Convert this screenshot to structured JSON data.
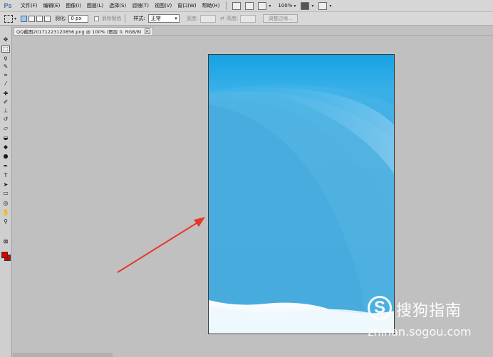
{
  "app": {
    "logo_text": "Ps"
  },
  "menubar": {
    "items": [
      "文件(F)",
      "编辑(E)",
      "图像(I)",
      "图层(L)",
      "选择(S)",
      "滤镜(T)",
      "视图(V)",
      "窗口(W)",
      "帮助(H)"
    ],
    "zoom_label": "100%",
    "arrow_glyph": "▾"
  },
  "options": {
    "feather_label": "羽化:",
    "feather_value": "0 px",
    "antialias_label": "消除锯齿",
    "style_label": "样式:",
    "style_value": "正常",
    "width_label": "宽度:",
    "height_label": "高度:",
    "refine_edge_label": "调整边缘..."
  },
  "document": {
    "tab_title": "QQ截图20171223120856.png @ 100% (图层 0, RGB/8)",
    "close_glyph": "×"
  },
  "watermark": {
    "logo_glyph": "S",
    "brand_text": "搜狗指南",
    "url_text": "zhinan.sogou.com"
  },
  "colors": {
    "foreground": "#e00000",
    "background": "#d40000",
    "arrow": "#e8352c",
    "sky_top": "#0ea5e4",
    "sky_bottom": "#49a9d9"
  },
  "tools": {
    "icons": [
      "move-icon",
      "marquee-icon",
      "lasso-icon",
      "quick-select-icon",
      "crop-icon",
      "eyedropper-icon",
      "healing-brush-icon",
      "brush-icon",
      "clone-stamp-icon",
      "history-brush-icon",
      "eraser-icon",
      "gradient-icon",
      "blur-icon",
      "dodge-icon",
      "pen-icon",
      "type-icon",
      "path-select-icon",
      "shape-icon",
      "3d-rotate-icon",
      "hand-icon",
      "zoom-icon",
      "quick-mask-icon"
    ]
  }
}
